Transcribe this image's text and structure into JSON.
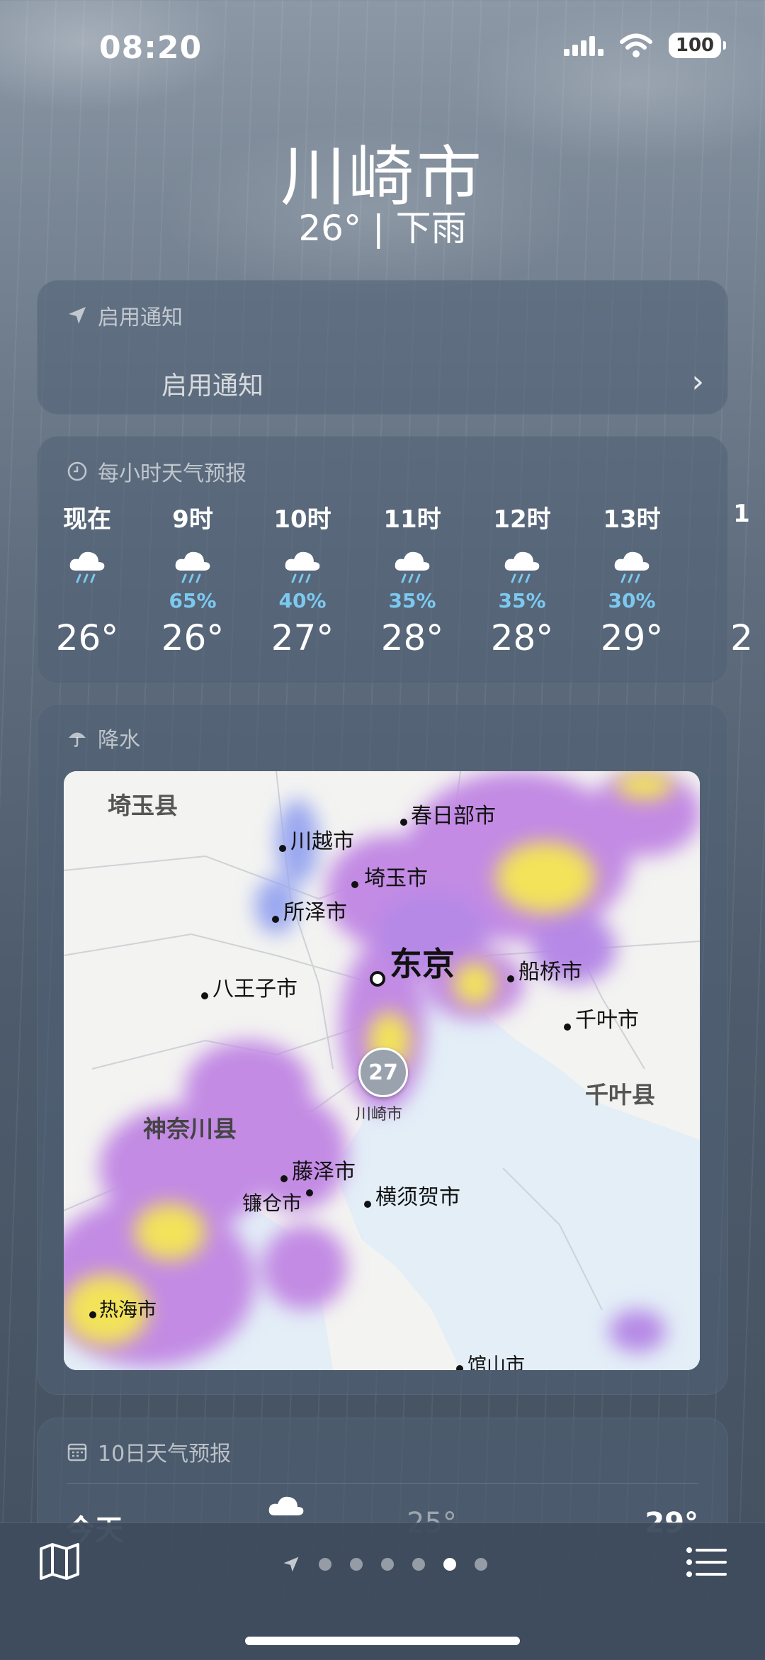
{
  "status": {
    "time": "08:20",
    "battery": "100"
  },
  "location": {
    "city": "川崎市",
    "summary": "26° | 下雨"
  },
  "notify_card": {
    "title": "启用通知",
    "link": "启用通知"
  },
  "hourly": {
    "title": "每小时天气预报",
    "items": [
      {
        "label": "现在",
        "pct": "",
        "temp": "26°"
      },
      {
        "label": "9时",
        "pct": "65%",
        "temp": "26°"
      },
      {
        "label": "10时",
        "pct": "40%",
        "temp": "27°"
      },
      {
        "label": "11时",
        "pct": "35%",
        "temp": "28°"
      },
      {
        "label": "12时",
        "pct": "35%",
        "temp": "28°"
      },
      {
        "label": "13时",
        "pct": "30%",
        "temp": "29°"
      },
      {
        "label": "1",
        "pct": "",
        "temp": "2"
      }
    ]
  },
  "precip": {
    "title": "降水",
    "marker": {
      "temp": "27",
      "name": "川崎市"
    },
    "regions": [
      "埼玉县",
      "神奈川县",
      "千叶县"
    ],
    "cities": [
      "春日部市",
      "川越市",
      "埼玉市",
      "所泽市",
      "东京",
      "船桥市",
      "八王子市",
      "千叶市",
      "藤泽市",
      "镰仓市",
      "横须贺市",
      "热海市",
      "馆山市"
    ]
  },
  "ten_day": {
    "title": "10日天气预报",
    "row_label": "今天",
    "low": "25°",
    "high": "29°"
  },
  "icons": [
    "location-arrow-icon",
    "clock-icon",
    "umbrella-icon",
    "calendar-icon",
    "cloud-rain-icon",
    "map-icon",
    "list-icon",
    "wifi-icon",
    "signal-icon",
    "chevron-right-icon"
  ]
}
